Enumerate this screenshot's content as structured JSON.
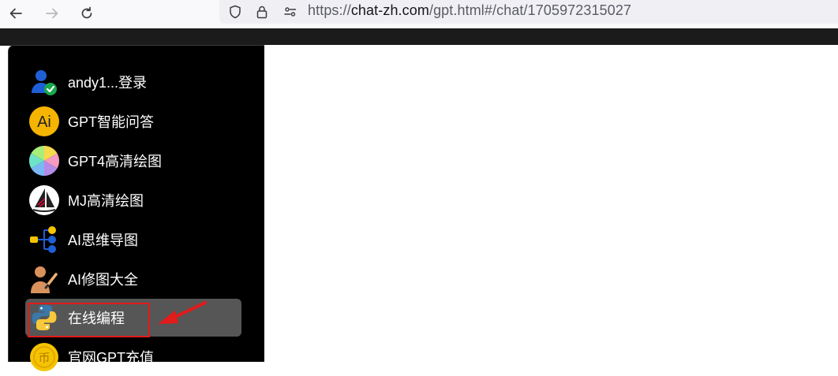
{
  "browser": {
    "url_prefix": "https://",
    "url_host": "chat-zh.com",
    "url_path": "/gpt.html#/chat/1705972315027",
    "back_icon": "arrow-left-icon",
    "forward_icon": "arrow-right-icon",
    "reload_icon": "reload-icon",
    "shield_icon": "shield-icon",
    "lock_icon": "lock-icon",
    "permissions_icon": "permissions-icon"
  },
  "sidebar": {
    "items": [
      {
        "label": "andy1...登录",
        "icon": "user-verified-icon"
      },
      {
        "label": "GPT智能问答",
        "icon": "ai-badge-icon"
      },
      {
        "label": "GPT4高清绘图",
        "icon": "color-wheel-icon"
      },
      {
        "label": "MJ高清绘图",
        "icon": "sailboat-icon"
      },
      {
        "label": "AI思维导图",
        "icon": "mindmap-icon"
      },
      {
        "label": "AI修图大全",
        "icon": "painter-icon"
      },
      {
        "label": "在线编程",
        "icon": "python-icon",
        "active": true
      },
      {
        "label": "官网GPT充值",
        "icon": "coin-icon"
      }
    ]
  },
  "annotation": {
    "highlight_color": "#e21b1b",
    "arrow_color": "#e21b1b"
  }
}
